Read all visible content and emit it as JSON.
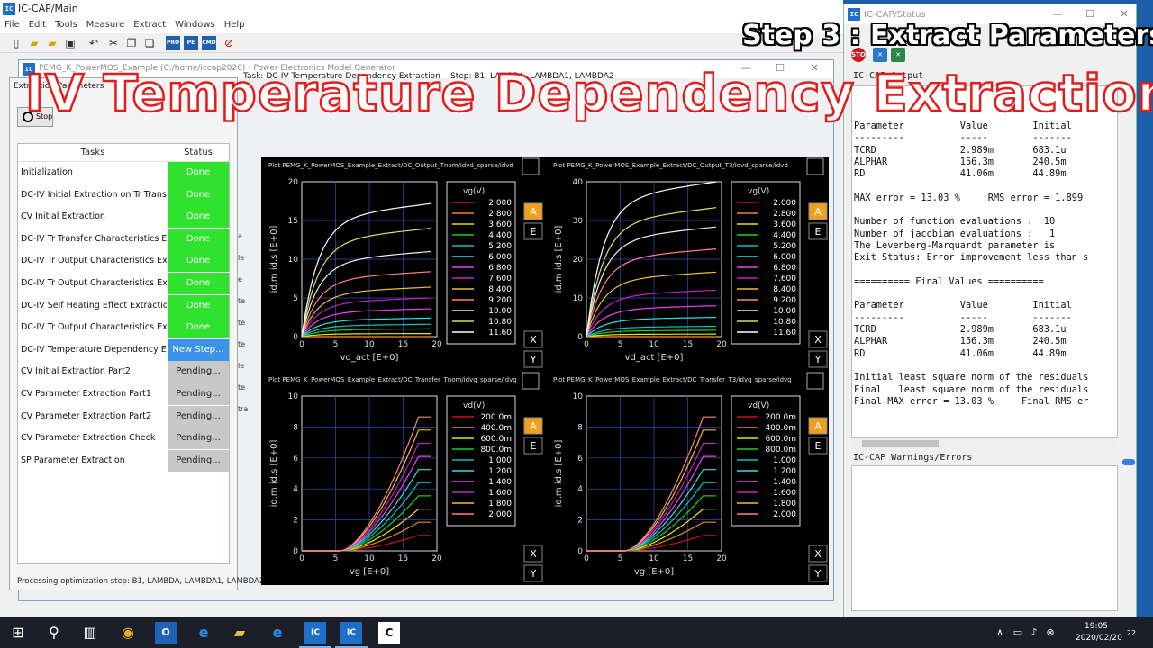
{
  "main_window": {
    "title": "IC-CAP/Main",
    "menu": [
      "File",
      "Edit",
      "Tools",
      "Measure",
      "Extract",
      "Windows",
      "Help"
    ],
    "toolbar_icons": [
      "new-file-icon",
      "open-folder-icon",
      "folder-icon",
      "save-icon",
      "cut-icon",
      "copy-icon",
      "paste-icon",
      "pro-icon",
      "pe-icon",
      "cmd-icon",
      "no-entry-icon"
    ]
  },
  "pemg_window": {
    "title": "PEMG_K_PowerMOS_Example (C:/home/iccap2020) - Power Electronics Model Generator",
    "task_line": "Task:  DC-IV Temperature Dependency Extraction",
    "step_line": "Step:  B1, LAMBDA, LAMBDA1, LAMBDA2",
    "left_strip": [
      "a",
      "le",
      "e",
      "te",
      "te",
      "te",
      "le",
      "te",
      "tra"
    ]
  },
  "task_panel": {
    "tab_label": "Extraction Parameters",
    "stop_label": "Stop",
    "columns": [
      "Tasks",
      "Status"
    ],
    "rows": [
      {
        "task": "Initialization",
        "status": "Done",
        "kind": "done"
      },
      {
        "task": "DC-IV Initial Extraction on Tr Transf...",
        "status": "Done",
        "kind": "done"
      },
      {
        "task": "CV Initial Extraction",
        "status": "Done",
        "kind": "done"
      },
      {
        "task": "DC-IV Tr Transfer Characteristics Ex...",
        "status": "Done",
        "kind": "done"
      },
      {
        "task": "DC-IV Tr Output Characteristics Ext...",
        "status": "Done",
        "kind": "done"
      },
      {
        "task": "DC-IV Tr Output Characteristics Ext...",
        "status": "Done",
        "kind": "done"
      },
      {
        "task": "DC-IV Self Heating Effect Extractio...",
        "status": "Done",
        "kind": "done"
      },
      {
        "task": "DC-IV Tr Output Characteristics Ext...",
        "status": "Done",
        "kind": "done"
      },
      {
        "task": "DC-IV Temperature Dependency E...",
        "status": "New Step...",
        "kind": "new"
      },
      {
        "task": "CV Initial Extraction Part2",
        "status": "Pending...",
        "kind": "pend"
      },
      {
        "task": "CV Parameter Extraction Part1",
        "status": "Pending...",
        "kind": "pend"
      },
      {
        "task": "CV Parameter Extraction Part2",
        "status": "Pending...",
        "kind": "pend"
      },
      {
        "task": "CV Parameter Extraction Check",
        "status": "Pending...",
        "kind": "pend"
      },
      {
        "task": "SP Parameter Extraction",
        "status": "Pending...",
        "kind": "pend"
      }
    ],
    "status_line": "Processing optimization step: B1, LAMBDA, LAMBDA1, LAMBDA2"
  },
  "plots": [
    {
      "title": "Plot PEMG_K_PowerMOS_Example_Extract/DC_Output_Tnom/idvd_sparse/idvd",
      "xlabel": "vd_act  [E+0]",
      "ylabel": "id.m  id.s  [E+0]",
      "xticks": [
        "0",
        "5",
        "10",
        "15",
        "20"
      ],
      "yticks": [
        "0",
        "5",
        "10",
        "15",
        "20"
      ],
      "legend_title": "vg(V)",
      "legend": [
        "2.000",
        "2.800",
        "3.600",
        "4.400",
        "5.200",
        "6.000",
        "6.800",
        "7.600",
        "8.400",
        "9.200",
        "10.00",
        "10.80",
        "11.60"
      ]
    },
    {
      "title": "Plot PEMG_K_PowerMOS_Example_Extract/DC_Output_T3/idvd_sparse/idvd",
      "xlabel": "vd_act  [E+0]",
      "ylabel": "id.m  id.s  [E+0]",
      "xticks": [
        "0",
        "5",
        "10",
        "15",
        "20"
      ],
      "yticks": [
        "0",
        "10",
        "20",
        "30",
        "40"
      ],
      "legend_title": "vg(V)",
      "legend": [
        "2.000",
        "2.800",
        "3.600",
        "4.400",
        "5.200",
        "6.000",
        "6.800",
        "7.600",
        "8.400",
        "9.200",
        "10.00",
        "10.80",
        "11.60"
      ]
    },
    {
      "title": "Plot PEMG_K_PowerMOS_Example_Extract/DC_Transfer_Tnom/idvg_sparse/idvg",
      "xlabel": "vg  [E+0]",
      "ylabel": "id.m  id.s  [E+0]",
      "xticks": [
        "0",
        "5",
        "10",
        "15",
        "20"
      ],
      "yticks": [
        "0",
        "2",
        "4",
        "6",
        "8",
        "10"
      ],
      "legend_title": "vd(V)",
      "legend": [
        "200.0m",
        "400.0m",
        "600.0m",
        "800.0m",
        "1.000",
        "1.200",
        "1.400",
        "1.600",
        "1.800",
        "2.000"
      ]
    },
    {
      "title": "Plot PEMG_K_PowerMOS_Example_Extract/DC_Transfer_T3/idvg_sparse/idvg",
      "xlabel": "vg  [E+0]",
      "ylabel": "id.m  id.s  [E+0]",
      "xticks": [
        "0",
        "5",
        "10",
        "15",
        "20"
      ],
      "yticks": [
        "0",
        "2",
        "4",
        "6",
        "8",
        "10"
      ],
      "legend_title": "vd(V)",
      "legend": [
        "200.0m",
        "400.0m",
        "600.0m",
        "800.0m",
        "1.000",
        "1.200",
        "1.400",
        "1.600",
        "1.800",
        "2.000"
      ]
    }
  ],
  "series_colors": [
    "#d01010",
    "#e88a20",
    "#e8e800",
    "#20d020",
    "#10c0c0",
    "#30e0e0",
    "#f040f0",
    "#c020c0",
    "#f0c030",
    "#ff8080",
    "#f0f0f0",
    "#e0e060",
    "#ffffff"
  ],
  "plot_buttons": {
    "a": "A",
    "e": "E",
    "x": "X",
    "y": "Y"
  },
  "status_window": {
    "title": "IC-CAP/Status",
    "output_label": "IC-CAP Output",
    "output_lines": [
      "Parameter          Value        Initial",
      "---------          -----        -------",
      "TCRD               2.989m       683.1u",
      "ALPHAR             156.3m       240.5m",
      "RD                 41.06m       44.89m",
      "",
      "MAX error = 13.03 %     RMS error = 1.899",
      "",
      "Number of function evaluations :  10",
      "Number of jacobian evaluations :   1",
      "The Levenberg-Marquardt parameter is",
      "Exit Status: Error improvement less than s",
      "",
      "========== Final Values ==========",
      "",
      "Parameter          Value        Initial",
      "---------          -----        -------",
      "TCRD               2.989m       683.1u",
      "ALPHAR             156.3m       240.5m",
      "RD                 41.06m       44.89m",
      "",
      "Initial least square norm of the residuals",
      "Final   least square norm of the residuals",
      "Final MAX error = 13.03 %     Final RMS er"
    ],
    "warnings_label": "IC-CAP Warnings/Errors"
  },
  "overlay": {
    "title": "IV Temperature Dependency Extraction",
    "step": "Step 3 : Extract Parameters"
  },
  "taskbar": {
    "time": "19:05",
    "date": "2020/02/20",
    "notification_count": "22"
  }
}
